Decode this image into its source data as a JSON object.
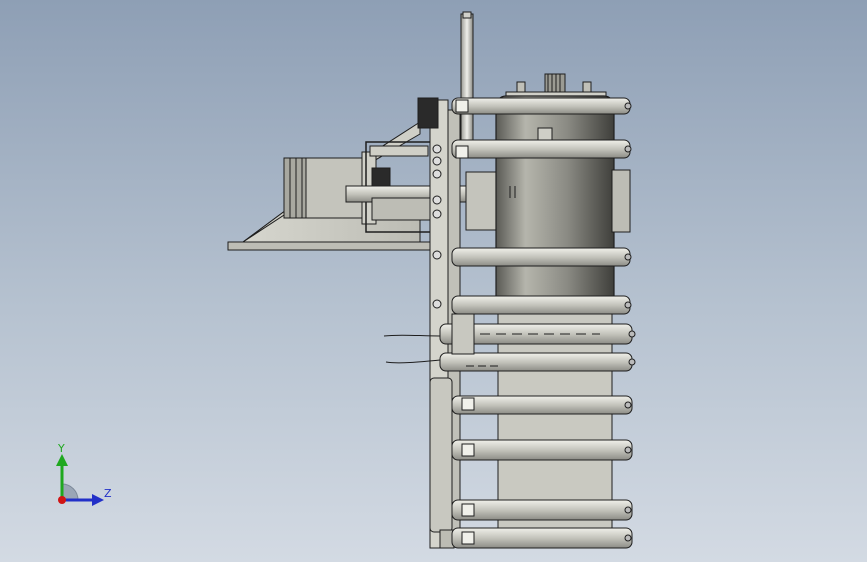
{
  "viewport": {
    "background_top": "#8e9fb5",
    "background_bottom": "#d3dae3"
  },
  "model": {
    "description_icon": "cad-assembly-icon",
    "body_color": "#c8c8c0",
    "drum_color": "#9a9a92",
    "edge_color": "#1e1e1e"
  },
  "triad": {
    "y_label": "Y",
    "z_label": "Z",
    "y_color": "#1fa81f",
    "z_color": "#2230c8",
    "x_color": "#d01515"
  }
}
